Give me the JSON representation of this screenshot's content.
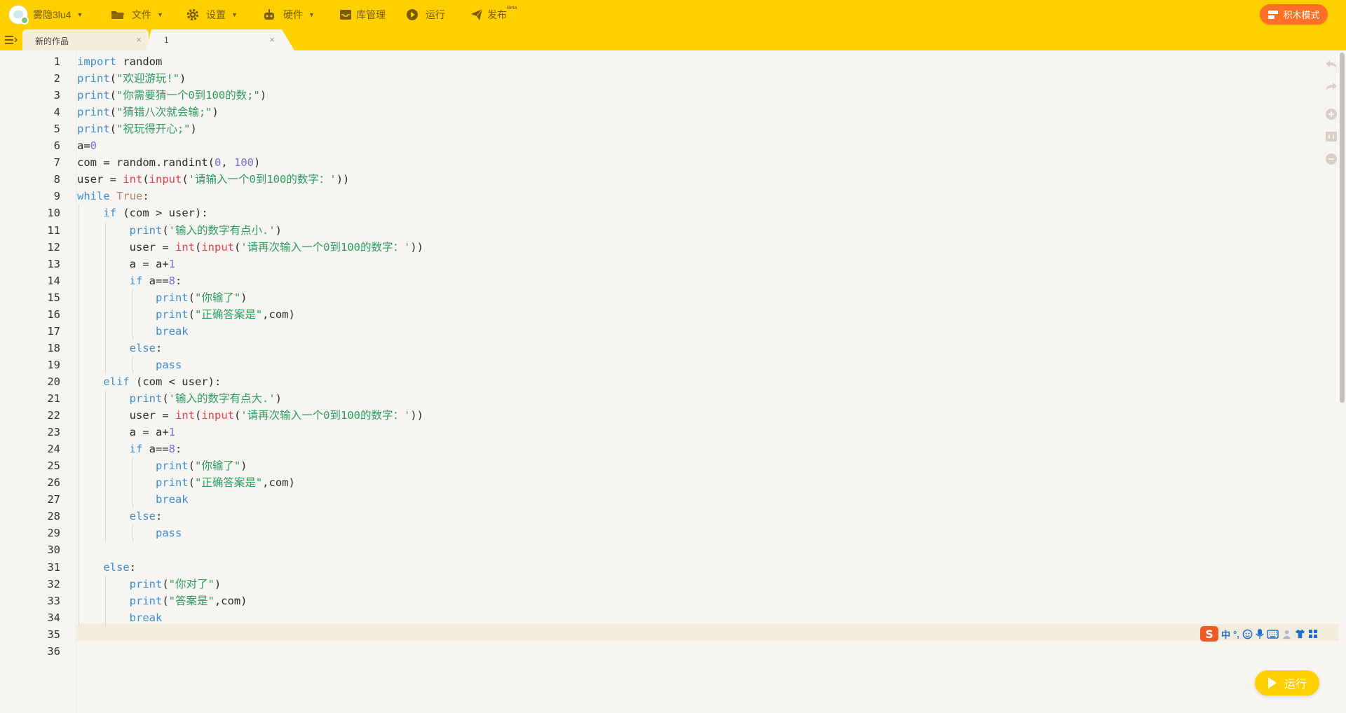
{
  "topbar": {
    "username": "雾隐3lu4",
    "menu": {
      "file": "文件",
      "settings": "设置",
      "hardware": "硬件",
      "library": "库管理",
      "run": "运行",
      "publish": "发布",
      "publish_sup": "Beta"
    },
    "block_mode": "积木模式",
    "accent_color": "#ffd000",
    "block_mode_color": "#ff6f25"
  },
  "tabs": [
    {
      "label": "新的作品",
      "close": "×"
    },
    {
      "label": "1",
      "close": "×"
    }
  ],
  "editor": {
    "current_line": 35,
    "lines": [
      "import random",
      "print(\"欢迎游玩!\")",
      "print(\"你需要猜一个0到100的数;\")",
      "print(\"猜错八次就会输;\")",
      "print(\"祝玩得开心;\")",
      "a=0",
      "com = random.randint(0, 100)",
      "user = int(input('请输入一个0到100的数字：'))",
      "while True:",
      "    if (com > user):",
      "        print('输入的数字有点小.')",
      "        user = int(input('请再次输入一个0到100的数字：'))",
      "        a = a+1",
      "        if a==8:",
      "            print(\"你输了\")",
      "            print(\"正确答案是\",com)",
      "            break",
      "        else:",
      "            pass",
      "    elif (com < user):",
      "        print('输入的数字有点大.')",
      "        user = int(input('请再次输入一个0到100的数字：'))",
      "        a = a+1",
      "        if a==8:",
      "            print(\"你输了\")",
      "            print(\"正确答案是\",com)",
      "            break",
      "        else:",
      "            pass",
      "",
      "    else:",
      "        print(\"你对了\")",
      "        print(\"答案是\",com)",
      "        break",
      "",
      ""
    ]
  },
  "ime": {
    "logo": "S",
    "lang": "中",
    "punct": "°,"
  },
  "run_button": "运行"
}
